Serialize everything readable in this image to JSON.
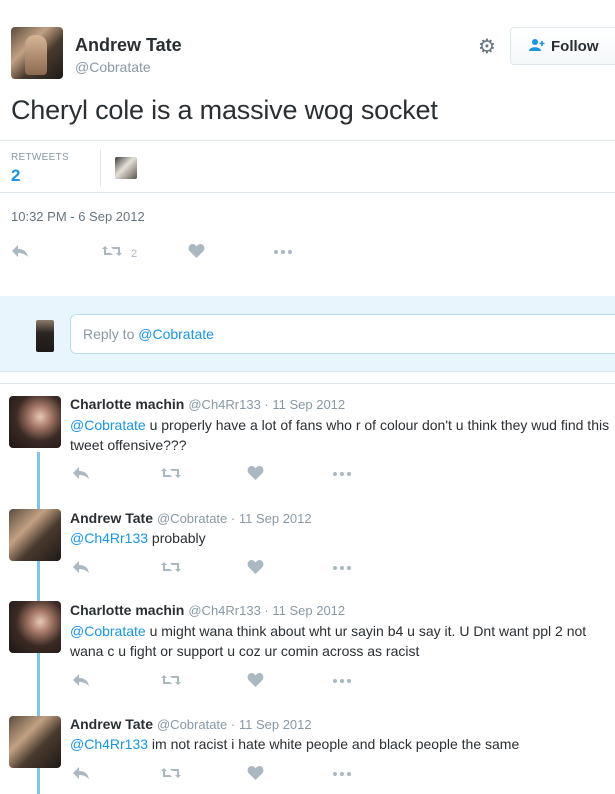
{
  "tweet": {
    "author_name": "Andrew Tate",
    "author_handle": "@Cobratate",
    "follow_label": "Follow",
    "text": "Cheryl cole is a massive wog socket",
    "retweets_label": "RETWEETS",
    "retweets_count": "2",
    "timestamp": "10:32 PM - 6 Sep 2012",
    "retweet_action_count": "2"
  },
  "icons": {
    "reply": "reply-icon",
    "retweet": "retweet-icon",
    "like": "heart-icon",
    "more": "more-icon",
    "gear": "gear-icon",
    "follow": "add-user-icon"
  },
  "reply_box": {
    "prefix": "Reply to ",
    "handle": "@Cobratate"
  },
  "colors": {
    "accent": "#1b95e0",
    "thread_line": "#82c3ec",
    "reply_band": "#e8f5fd",
    "muted": "#8899a6"
  },
  "replies": [
    {
      "name": "Charlotte machin",
      "handle": "@Ch4Rr133",
      "date": "11 Sep 2012",
      "mention": "@Cobratate",
      "text": " u properly have a lot of fans who r of colour don't u think they wud find this tweet offensive???"
    },
    {
      "name": "Andrew Tate",
      "handle": "@Cobratate",
      "date": "11 Sep 2012",
      "mention": "@Ch4Rr133",
      "text": " probably"
    },
    {
      "name": "Charlotte machin",
      "handle": "@Ch4Rr133",
      "date": "11 Sep 2012",
      "mention": "@Cobratate",
      "text": " u might wana think about wht ur sayin b4 u say it. U Dnt want ppl 2 not wana c u fight or support u coz ur comin across as racist"
    },
    {
      "name": "Andrew Tate",
      "handle": "@Cobratate",
      "date": "11 Sep 2012",
      "mention": "@Ch4Rr133",
      "text": " im not racist i hate white people and black people the same"
    }
  ]
}
